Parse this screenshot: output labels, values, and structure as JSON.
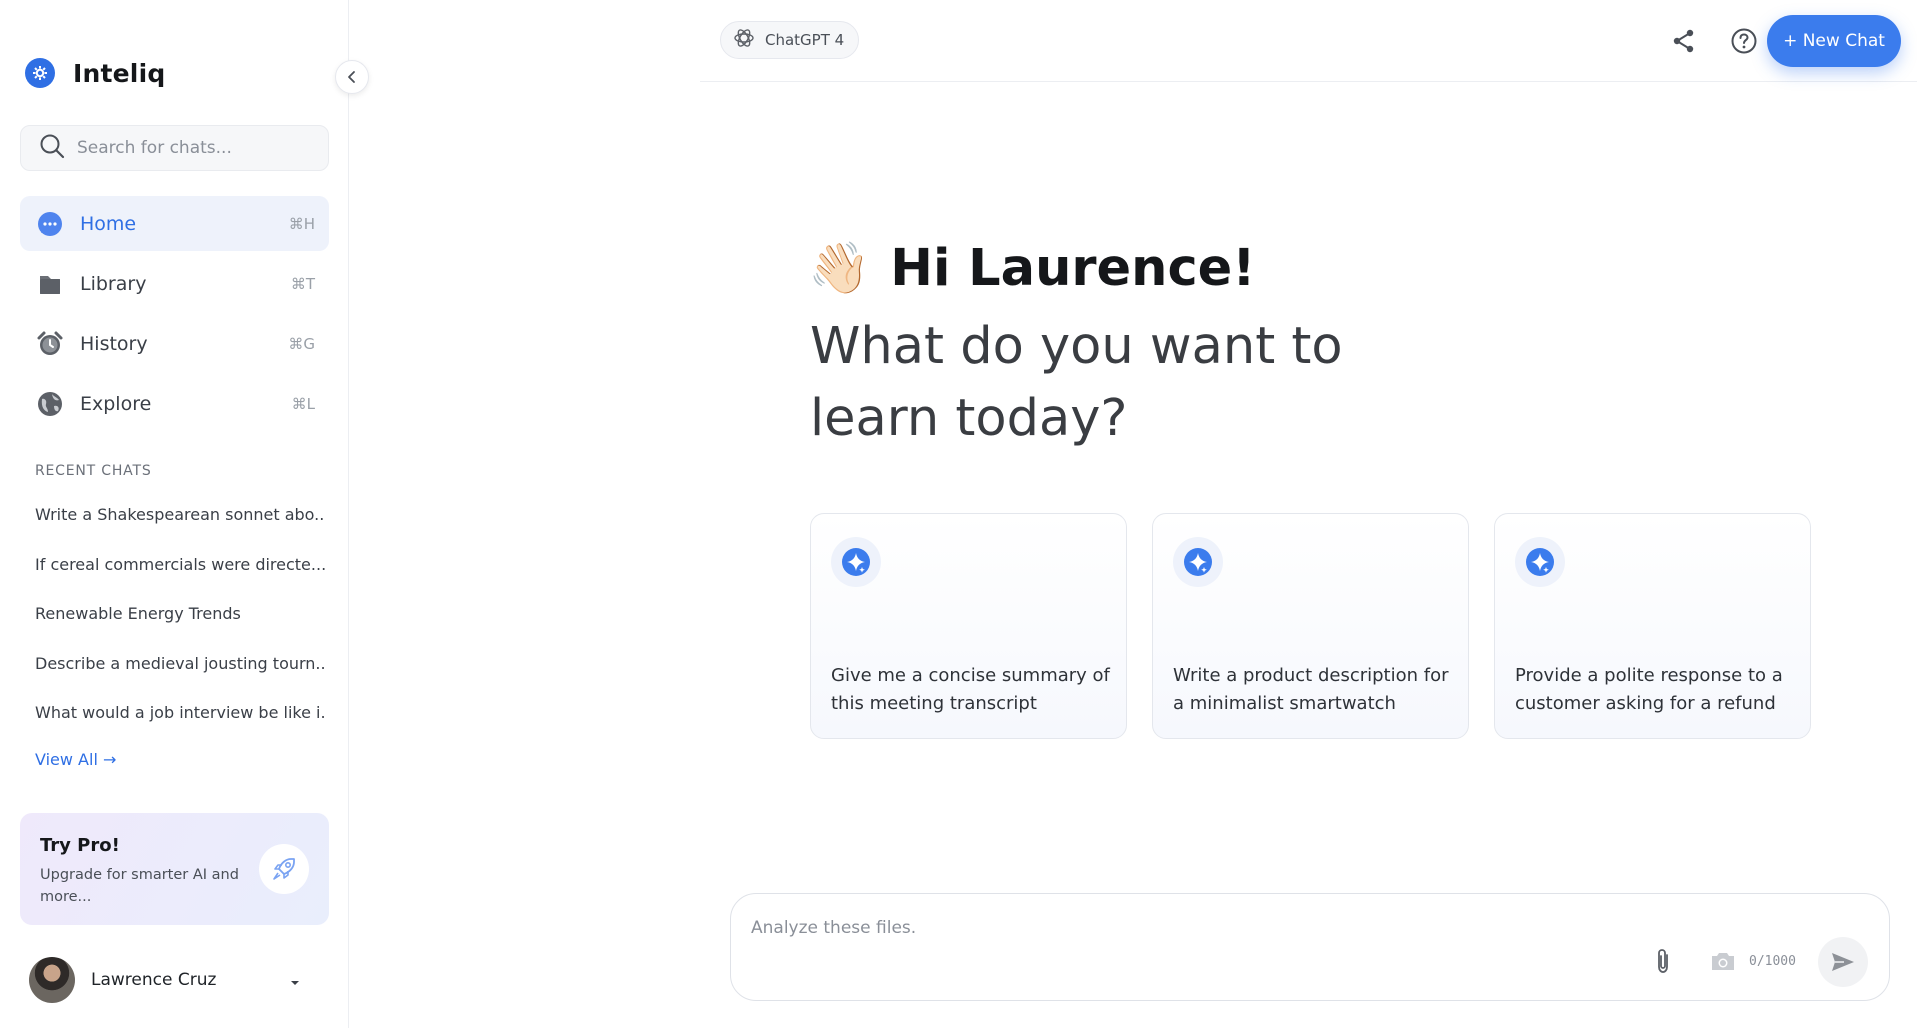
{
  "app": {
    "name": "Inteliq"
  },
  "search": {
    "placeholder": "Search for chats..."
  },
  "nav": [
    {
      "label": "Home",
      "shortcut": "⌘H",
      "icon": "chat-bubble-icon",
      "active": true
    },
    {
      "label": "Library",
      "shortcut": "⌘T",
      "icon": "folder-icon",
      "active": false
    },
    {
      "label": "History",
      "shortcut": "⌘G",
      "icon": "alarm-clock-icon",
      "active": false
    },
    {
      "label": "Explore",
      "shortcut": "⌘L",
      "icon": "globe-icon",
      "active": false
    }
  ],
  "recent": {
    "heading": "RECENT CHATS",
    "items": [
      "Write a Shakespearean sonnet abo...",
      "If cereal commercials were directe...",
      "Renewable Energy Trends",
      "Describe a medieval jousting tourn...",
      "What would a job interview be like i..."
    ],
    "view_all": "View All →"
  },
  "pro": {
    "title": "Try Pro!",
    "text": "Upgrade for smarter AI and more..."
  },
  "user": {
    "name": "Lawrence Cruz"
  },
  "topbar": {
    "model": "ChatGPT 4",
    "new_chat": "+ New Chat"
  },
  "hero": {
    "wave": "👋🏻",
    "greeting": "Hi Laurence!",
    "question": "What do you want to learn today?"
  },
  "cards": [
    {
      "text": "Give me a concise summary of this meeting transcript"
    },
    {
      "text": "Write a product description for a minimalist smartwatch"
    },
    {
      "text": "Provide a polite response to a customer asking for a refund"
    }
  ],
  "composer": {
    "placeholder": "Analyze these files.",
    "counter": "0/1000"
  },
  "colors": {
    "accent": "#3b7ced",
    "brand": "#2f6fe4",
    "active_bg": "#eef2fb"
  }
}
